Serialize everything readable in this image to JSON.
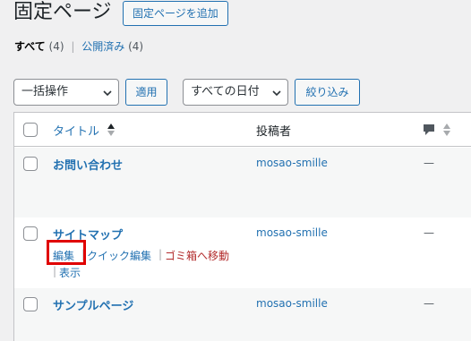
{
  "header": {
    "title": "固定ページ",
    "add_new_label": "固定ページを追加"
  },
  "filters": {
    "all_label": "すべて",
    "all_count": "(4)",
    "separator": "|",
    "published_label": "公開済み",
    "published_count": "(4)"
  },
  "bulk": {
    "action_selected": "一括操作",
    "apply_label": "適用",
    "date_selected": "すべての日付",
    "filter_label": "絞り込み"
  },
  "table": {
    "columns": {
      "title": "タイトル",
      "author": "投稿者"
    },
    "rows": [
      {
        "title": "お問い合わせ",
        "author": "mosao-smille",
        "comments": "—"
      },
      {
        "title": "サイトマップ",
        "author": "mosao-smille",
        "comments": "—",
        "actions": {
          "edit": "編集",
          "quick_edit": "クイック編集",
          "trash": "ゴミ箱へ移動",
          "view": "表示",
          "sep": "|"
        }
      },
      {
        "title": "サンプルページ",
        "author": "mosao-smille",
        "comments": "—"
      }
    ]
  },
  "colors": {
    "link": "#2271b1",
    "trash": "#b32d2e",
    "highlight": "#e00000"
  },
  "icons": [
    "sort-icon",
    "comment-icon",
    "chevron-down-icon"
  ]
}
